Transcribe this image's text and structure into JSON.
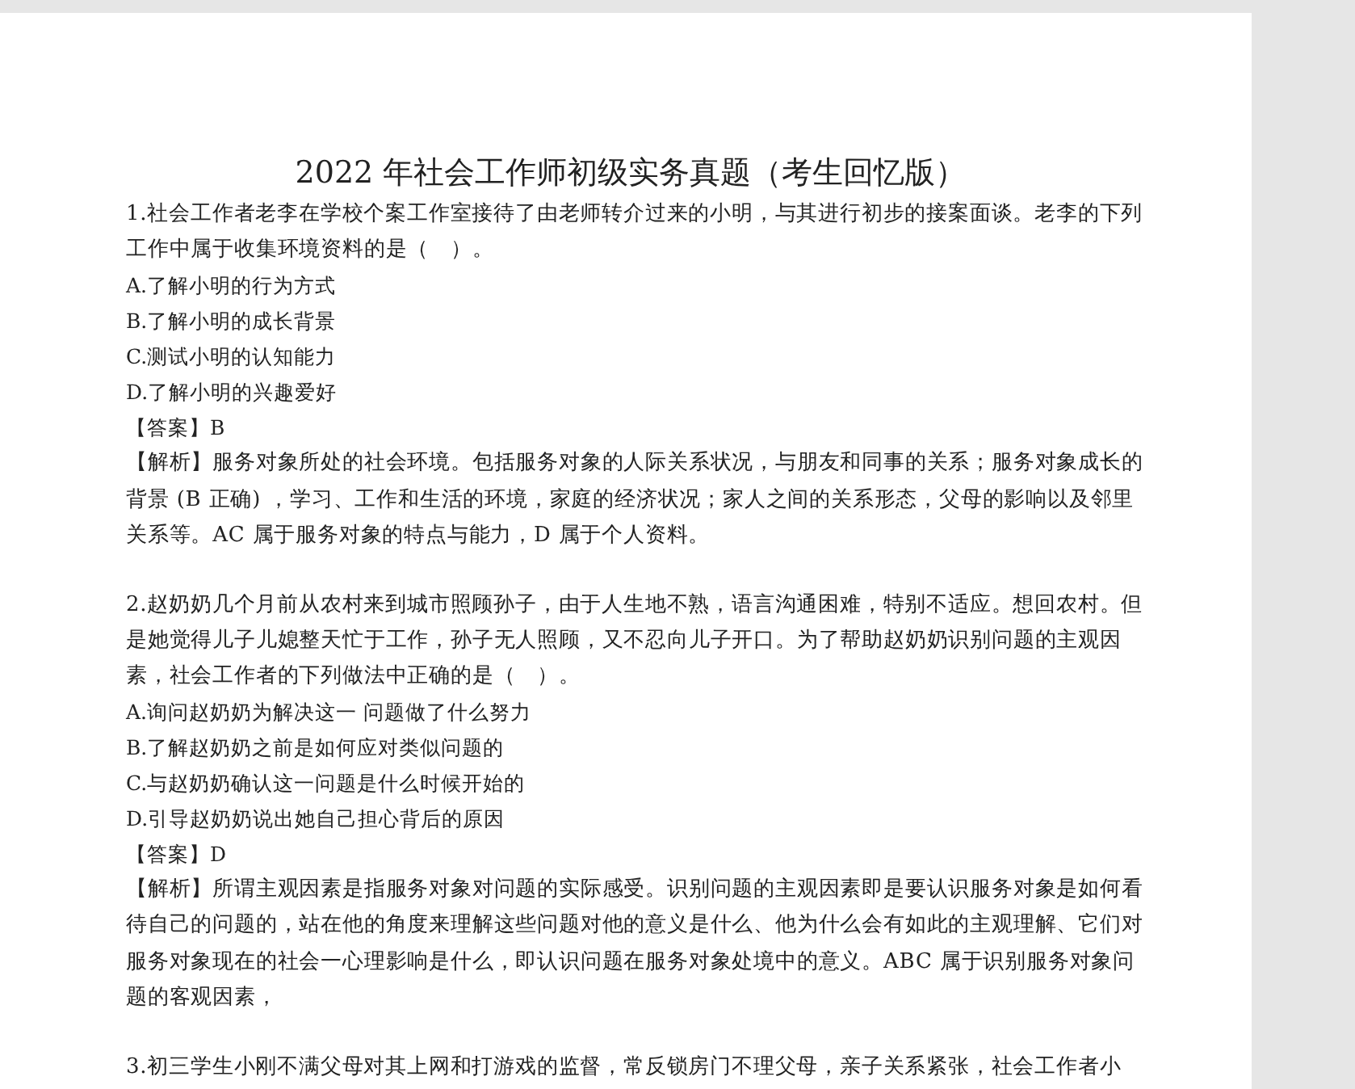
{
  "document": {
    "title": "2022 年社会工作师初级实务真题（考生回忆版）",
    "questions": [
      {
        "stem": "1.社会工作者老李在学校个案工作室接待了由老师转介过来的小明，与其进行初步的接案面谈。老李的下列工作中属于收集环境资料的是（　）。",
        "options": [
          "A.了解小明的行为方式",
          "B.了解小明的成长背景",
          "C.测试小明的认知能力",
          "D.了解小明的兴趣爱好"
        ],
        "answer": "【答案】B",
        "analysis": "【解析】服务对象所处的社会环境。包括服务对象的人际关系状况，与朋友和同事的关系；服务对象成长的背景 (B 正确) ，学习、工作和生活的环境，家庭的经济状况；家人之间的关系形态，父母的影响以及邻里关系等。AC 属于服务对象的特点与能力，D 属于个人资料。"
      },
      {
        "stem": "2.赵奶奶几个月前从农村来到城市照顾孙子，由于人生地不熟，语言沟通困难，特别不适应。想回农村。但是她觉得儿子儿媳整天忙于工作，孙子无人照顾，又不忍向儿子开口。为了帮助赵奶奶识别问题的主观因素，社会工作者的下列做法中正确的是（　）。",
        "options": [
          "A.询问赵奶奶为解决这一 问题做了什么努力",
          "B.了解赵奶奶之前是如何应对类似问题的",
          "C.与赵奶奶确认这一问题是什么时候开始的",
          "D.引导赵奶奶说出她自己担心背后的原因"
        ],
        "answer": "【答案】D",
        "analysis": "【解析】所谓主观因素是指服务对象对问题的实际感受。识别问题的主观因素即是要认识服务对象是如何看待自己的问题的，站在他的角度来理解这些问题对他的意义是什么、他为什么会有如此的主观理解、它们对服务对象现在的社会一心理影响是什么，即认识问题在服务对象处境中的意义。ABC 属于识别服务对象问题的客观因素，"
      },
      {
        "stem": "3.初三学生小刚不满父母对其上网和打游戏的监督，常反锁房门不理父母，亲子关系紧张，社会工作者小"
      }
    ]
  }
}
